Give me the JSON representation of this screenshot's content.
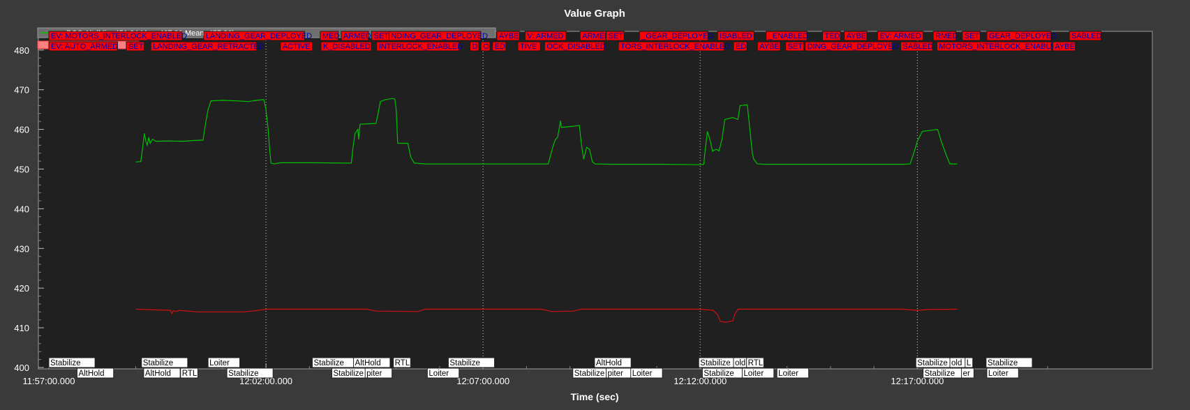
{
  "window": {
    "title": "Value Graph",
    "xlabel": "Time (sec)"
  },
  "colors": {
    "background": "#3a3a3a",
    "plot_area": "#202020",
    "alt_series": "#00c000",
    "target_series": "#d01010",
    "event_box": "#ff0000",
    "mode_box": "#ffffff",
    "legend_box": "#6e6e6e"
  },
  "legend": [
    {
      "label": "POS.Alt  (Min: 451.24 Max: 467.99 Mean: 457.26)",
      "color": "#00c000"
    },
    {
      "label": "",
      "color": "#ff8080"
    }
  ],
  "events": {
    "row1": [
      {
        "t": 0,
        "text": "EV: MOTORS_INTERLOCK_ENABLED"
      },
      {
        "t": 214,
        "text": "LANDING_GEAR_DEPLOYED"
      },
      {
        "t": 375,
        "text": "MED"
      },
      {
        "t": 404,
        "text": "ARMED"
      },
      {
        "t": 446,
        "text": "SET"
      },
      {
        "t": 470,
        "text": "NDING_GEAR_DEPLOYED"
      },
      {
        "t": 619,
        "text": "AYBE"
      },
      {
        "t": 658,
        "text": "V: ARMED"
      },
      {
        "t": 734,
        "text": "ARMED"
      },
      {
        "t": 770,
        "text": "SET"
      },
      {
        "t": 816,
        "text": "_GEAR_DEPLOYED"
      },
      {
        "t": 924,
        "text": "ISABLED"
      },
      {
        "t": 991,
        "text": "_ENABLED"
      },
      {
        "t": 1069,
        "text": "TED"
      },
      {
        "t": 1099,
        "text": "AYBE"
      },
      {
        "t": 1145,
        "text": "EV: ARMED"
      },
      {
        "t": 1222,
        "text": "RMED"
      },
      {
        "t": 1262,
        "text": "SET"
      },
      {
        "t": 1296,
        "text": "GEAR_DEPLOYED"
      },
      {
        "t": 1410,
        "text": "SABLED"
      }
    ],
    "row2": [
      {
        "t": 0,
        "text": "EV: AUTO_ARMED"
      },
      {
        "t": 107,
        "text": "SET"
      },
      {
        "t": 141,
        "text": "LANDING_GEAR_RETRACTED"
      },
      {
        "t": 320,
        "text": "ACTIVE"
      },
      {
        "t": 376,
        "text": "K_DISABLED"
      },
      {
        "t": 453,
        "text": "INTERLOCK_ENABLED"
      },
      {
        "t": 582,
        "text": "D"
      },
      {
        "t": 597,
        "text": "O"
      },
      {
        "t": 613,
        "text": "ED"
      },
      {
        "t": 648,
        "text": "TIVE"
      },
      {
        "t": 685,
        "text": "OCK_DISABLED"
      },
      {
        "t": 787,
        "text": "TORS_INTERLOCK_ENABLED"
      },
      {
        "t": 946,
        "text": "ED"
      },
      {
        "t": 979,
        "text": "AYBE"
      },
      {
        "t": 1018,
        "text": "SET"
      },
      {
        "t": 1045,
        "text": "DING_GEAR_DEPLOYED"
      },
      {
        "t": 1177,
        "text": "SABLED"
      },
      {
        "t": 1227,
        "text": "MOTORS_INTERLOCK_ENABLED"
      },
      {
        "t": 1387,
        "text": "AYBE"
      }
    ]
  },
  "modes": {
    "row1": [
      {
        "t": 0,
        "text": "Stabilize"
      },
      {
        "t": 128,
        "text": "Stabilize"
      },
      {
        "t": 220,
        "text": "Loiter"
      },
      {
        "t": 364,
        "text": "Stabilize"
      },
      {
        "t": 421,
        "text": "AltHold"
      },
      {
        "t": 476,
        "text": "RTL"
      },
      {
        "t": 552,
        "text": "Stabilize"
      },
      {
        "t": 754,
        "text": "AltHold"
      },
      {
        "t": 898,
        "text": "Stabilize"
      },
      {
        "t": 946,
        "text": "old"
      },
      {
        "t": 964,
        "text": "RTL"
      },
      {
        "t": 1198,
        "text": "Stabilize"
      },
      {
        "t": 1245,
        "text": "old"
      },
      {
        "t": 1266,
        "text": "L"
      },
      {
        "t": 1295,
        "text": "Stabilize"
      }
    ],
    "row2": [
      {
        "t": 39,
        "text": "AltHold"
      },
      {
        "t": 131,
        "text": "AltHold"
      },
      {
        "t": 182,
        "text": "RTL"
      },
      {
        "t": 246,
        "text": "Stabilize"
      },
      {
        "t": 391,
        "text": "Stabilize"
      },
      {
        "t": 437,
        "text": "piter"
      },
      {
        "t": 523,
        "text": "Loiter"
      },
      {
        "t": 724,
        "text": "Stabilize"
      },
      {
        "t": 770,
        "text": "piter"
      },
      {
        "t": 804,
        "text": "Loiter"
      },
      {
        "t": 903,
        "text": "Stabilize"
      },
      {
        "t": 958,
        "text": "Loiter"
      },
      {
        "t": 1006,
        "text": "Loiter"
      },
      {
        "t": 1208,
        "text": "Stabilize"
      },
      {
        "t": 1261,
        "text": "er"
      },
      {
        "t": 1296,
        "text": "Loiter"
      }
    ]
  },
  "chart_data": {
    "type": "line",
    "title": "Value Graph",
    "xlabel": "Time (sec)",
    "ylabel": "",
    "xlim": [
      0,
      1380
    ],
    "ylim": [
      400,
      484
    ],
    "x_unit": "seconds after 11:57:00.000",
    "x_ticks": [
      {
        "t": 0,
        "label": "11:57:00.000"
      },
      {
        "t": 300,
        "label": "12:02:00.000"
      },
      {
        "t": 600,
        "label": "12:07:00.000"
      },
      {
        "t": 900,
        "label": "12:12:00.000"
      },
      {
        "t": 1200,
        "label": "12:17:00.000"
      }
    ],
    "y_ticks": [
      400,
      410,
      420,
      430,
      440,
      450,
      460,
      470,
      480
    ],
    "grid": false,
    "legend_position": "top-left",
    "series": [
      {
        "name": "POS.Alt",
        "color": "#00c000",
        "points": [
          [
            120,
            451.8
          ],
          [
            127,
            451.9
          ],
          [
            130,
            456
          ],
          [
            132,
            459
          ],
          [
            134,
            457
          ],
          [
            136,
            456
          ],
          [
            138,
            458
          ],
          [
            140,
            456.5
          ],
          [
            143,
            457.5
          ],
          [
            148,
            457
          ],
          [
            165,
            457.1
          ],
          [
            185,
            457
          ],
          [
            200,
            457.2
          ],
          [
            213,
            457.3
          ],
          [
            217,
            462
          ],
          [
            220,
            465
          ],
          [
            224,
            467.2
          ],
          [
            240,
            467.3
          ],
          [
            260,
            467.2
          ],
          [
            275,
            467
          ],
          [
            286,
            467.3
          ],
          [
            297,
            467.5
          ],
          [
            300,
            465
          ],
          [
            303,
            460
          ],
          [
            305,
            455
          ],
          [
            307,
            451.5
          ],
          [
            311,
            451.3
          ],
          [
            320,
            451.6
          ],
          [
            360,
            451.6
          ],
          [
            410,
            451.5
          ],
          [
            418,
            451.5
          ],
          [
            420,
            455
          ],
          [
            423,
            459
          ],
          [
            427,
            460
          ],
          [
            428,
            457.5
          ],
          [
            430,
            461.3
          ],
          [
            440,
            461.4
          ],
          [
            452,
            461.5
          ],
          [
            455,
            464
          ],
          [
            458,
            467
          ],
          [
            465,
            467.5
          ],
          [
            475,
            467.8
          ],
          [
            478,
            467.6
          ],
          [
            480,
            465
          ],
          [
            482,
            456.5
          ],
          [
            496,
            456.5
          ],
          [
            500,
            453
          ],
          [
            505,
            451.5
          ],
          [
            520,
            451.3
          ],
          [
            600,
            451.3
          ],
          [
            690,
            451.3
          ],
          [
            694,
            454
          ],
          [
            697,
            456
          ],
          [
            700,
            457.5
          ],
          [
            703,
            458
          ],
          [
            707,
            462.2
          ],
          [
            708,
            460.5
          ],
          [
            725,
            460.8
          ],
          [
            733,
            461
          ],
          [
            736,
            456
          ],
          [
            739,
            452.5
          ],
          [
            743,
            455.5
          ],
          [
            747,
            455
          ],
          [
            751,
            451.8
          ],
          [
            755,
            451.3
          ],
          [
            780,
            451.2
          ],
          [
            850,
            451.2
          ],
          [
            898,
            451.1
          ],
          [
            905,
            451.2
          ],
          [
            907,
            455
          ],
          [
            910,
            459.5
          ],
          [
            914,
            457
          ],
          [
            917,
            454.5
          ],
          [
            922,
            455
          ],
          [
            926,
            454.6
          ],
          [
            930,
            457.5
          ],
          [
            934,
            462.5
          ],
          [
            945,
            463
          ],
          [
            952,
            462.5
          ],
          [
            955,
            466
          ],
          [
            965,
            466.2
          ],
          [
            968,
            461
          ],
          [
            972,
            454
          ],
          [
            974,
            452.5
          ],
          [
            979,
            451.3
          ],
          [
            990,
            451.2
          ],
          [
            1100,
            451.2
          ],
          [
            1180,
            451.2
          ],
          [
            1190,
            451.3
          ],
          [
            1195,
            454
          ],
          [
            1200,
            457
          ],
          [
            1207,
            459.5
          ],
          [
            1220,
            459.8
          ],
          [
            1228,
            460
          ],
          [
            1233,
            457
          ],
          [
            1240,
            453.5
          ],
          [
            1245,
            451.3
          ],
          [
            1255,
            451.3
          ]
        ]
      },
      {
        "name": "",
        "color": "#d01010",
        "points": [
          [
            120,
            414.7
          ],
          [
            150,
            414.5
          ],
          [
            168,
            414.4
          ],
          [
            170,
            413.6
          ],
          [
            172,
            414.3
          ],
          [
            176,
            414.1
          ],
          [
            180,
            414.4
          ],
          [
            205,
            414
          ],
          [
            270,
            414
          ],
          [
            285,
            414.3
          ],
          [
            300,
            414.7
          ],
          [
            440,
            414.7
          ],
          [
            452,
            414.2
          ],
          [
            510,
            414.1
          ],
          [
            520,
            414.7
          ],
          [
            680,
            414.7
          ],
          [
            695,
            414.1
          ],
          [
            725,
            414.2
          ],
          [
            735,
            414.7
          ],
          [
            900,
            414.7
          ],
          [
            918,
            414.4
          ],
          [
            924,
            413.3
          ],
          [
            928,
            411.6
          ],
          [
            935,
            411.4
          ],
          [
            945,
            411.7
          ],
          [
            948,
            413.5
          ],
          [
            952,
            414.7
          ],
          [
            1180,
            414.7
          ],
          [
            1200,
            414.4
          ],
          [
            1215,
            414.6
          ],
          [
            1255,
            414.7
          ]
        ]
      }
    ]
  }
}
